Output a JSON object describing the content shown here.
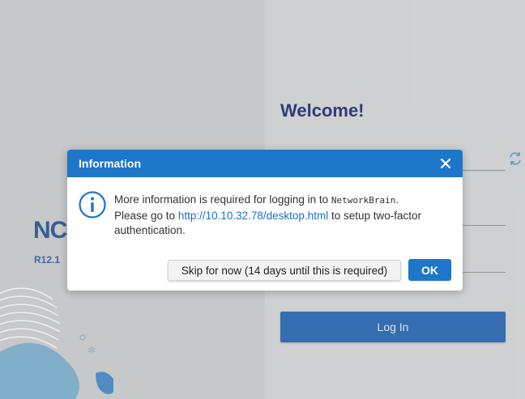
{
  "login": {
    "brand": "NC",
    "version": "R12.1",
    "welcome": "Welcome!",
    "login_button": "Log In"
  },
  "dialog": {
    "title": "Information",
    "message_line1_prefix": "More information is required for logging in to ",
    "product_name": "NetworkBrain",
    "message_line1_suffix": ".",
    "message_line2_prefix": "Please go to ",
    "link_text": "http://10.10.32.78/desktop.html",
    "message_line2_suffix": " to setup two-factor",
    "message_line3": "authentication.",
    "skip_button": "Skip for now (14 days until this is required)",
    "ok_button": "OK"
  },
  "icons": {
    "close": "close-icon",
    "info": "info-icon",
    "refresh": "refresh-icon"
  },
  "colors": {
    "accent": "#1e76c9",
    "welcome": "#12236d",
    "login_button": "#1a5fad"
  }
}
